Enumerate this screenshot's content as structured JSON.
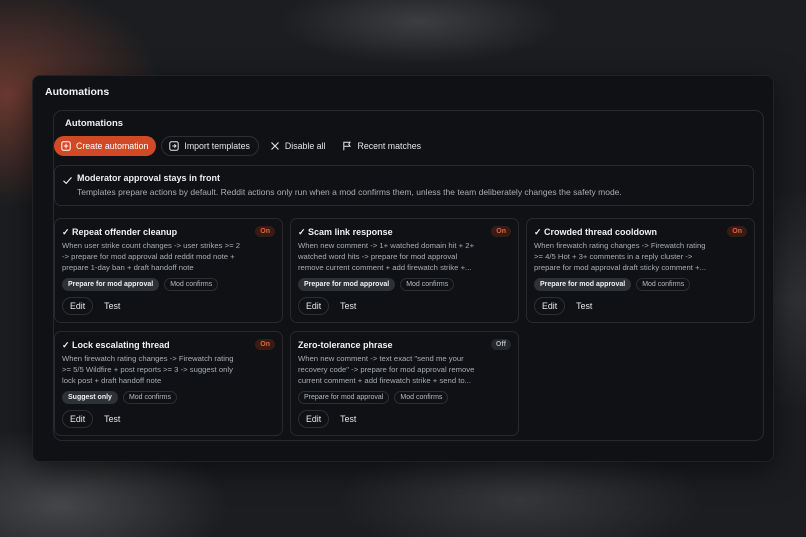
{
  "window": {
    "title": "Automations"
  },
  "panel": {
    "title": "Automations",
    "toolbar": {
      "create_label": "Create automation",
      "import_label": "Import templates",
      "disable_label": "Disable all",
      "recent_label": "Recent matches"
    },
    "notice": {
      "title": "Moderator approval stays in front",
      "text": "Templates prepare actions by default. Reddit actions only run when a mod confirms them, unless the team deliberately changes the safety mode."
    },
    "cards": [
      {
        "title": "Repeat offender cleanup",
        "status": "On",
        "description": "When user strike count changes -> user strikes >= 2\n-> prepare for mod approval add reddit mod note +\nprepare 1-day ban + draft handoff note",
        "tags": [
          "Prepare for mod approval",
          "Mod confirms"
        ],
        "edit_label": "Edit",
        "test_label": "Test"
      },
      {
        "title": "Scam link response",
        "status": "On",
        "description": "When new comment -> 1+ watched domain hit + 2+\nwatched word hits -> prepare for mod approval\nremove current comment + add firewatch strike +...",
        "tags": [
          "Prepare for mod approval",
          "Mod confirms"
        ],
        "edit_label": "Edit",
        "test_label": "Test"
      },
      {
        "title": "Crowded thread cooldown",
        "status": "On",
        "description": "When firewatch rating changes -> Firewatch rating\n>= 4/5 Hot + 3+ comments in a reply cluster ->\nprepare for mod approval draft sticky comment +...",
        "tags": [
          "Prepare for mod approval",
          "Mod confirms"
        ],
        "edit_label": "Edit",
        "test_label": "Test"
      },
      {
        "title": "Lock escalating thread",
        "status": "On",
        "description": "When firewatch rating changes -> Firewatch rating\n>= 5/5 Wildfire + post reports >= 3 -> suggest only\nlock post + draft handoff note",
        "tags": [
          "Suggest only",
          "Mod confirms"
        ],
        "edit_label": "Edit",
        "test_label": "Test"
      },
      {
        "title": "Zero-tolerance phrase",
        "status": "Off",
        "description": "When new comment -> text exact \"send me your\nrecovery code\" -> prepare for mod approval remove\ncurrent comment + add firewatch strike + send to...",
        "tags": [
          "Prepare for mod approval",
          "Mod confirms"
        ],
        "edit_label": "Edit",
        "test_label": "Test"
      }
    ]
  },
  "colors": {
    "accent": "#d14a26",
    "on_badge_text": "#e2643f",
    "background": "#0f1114"
  }
}
